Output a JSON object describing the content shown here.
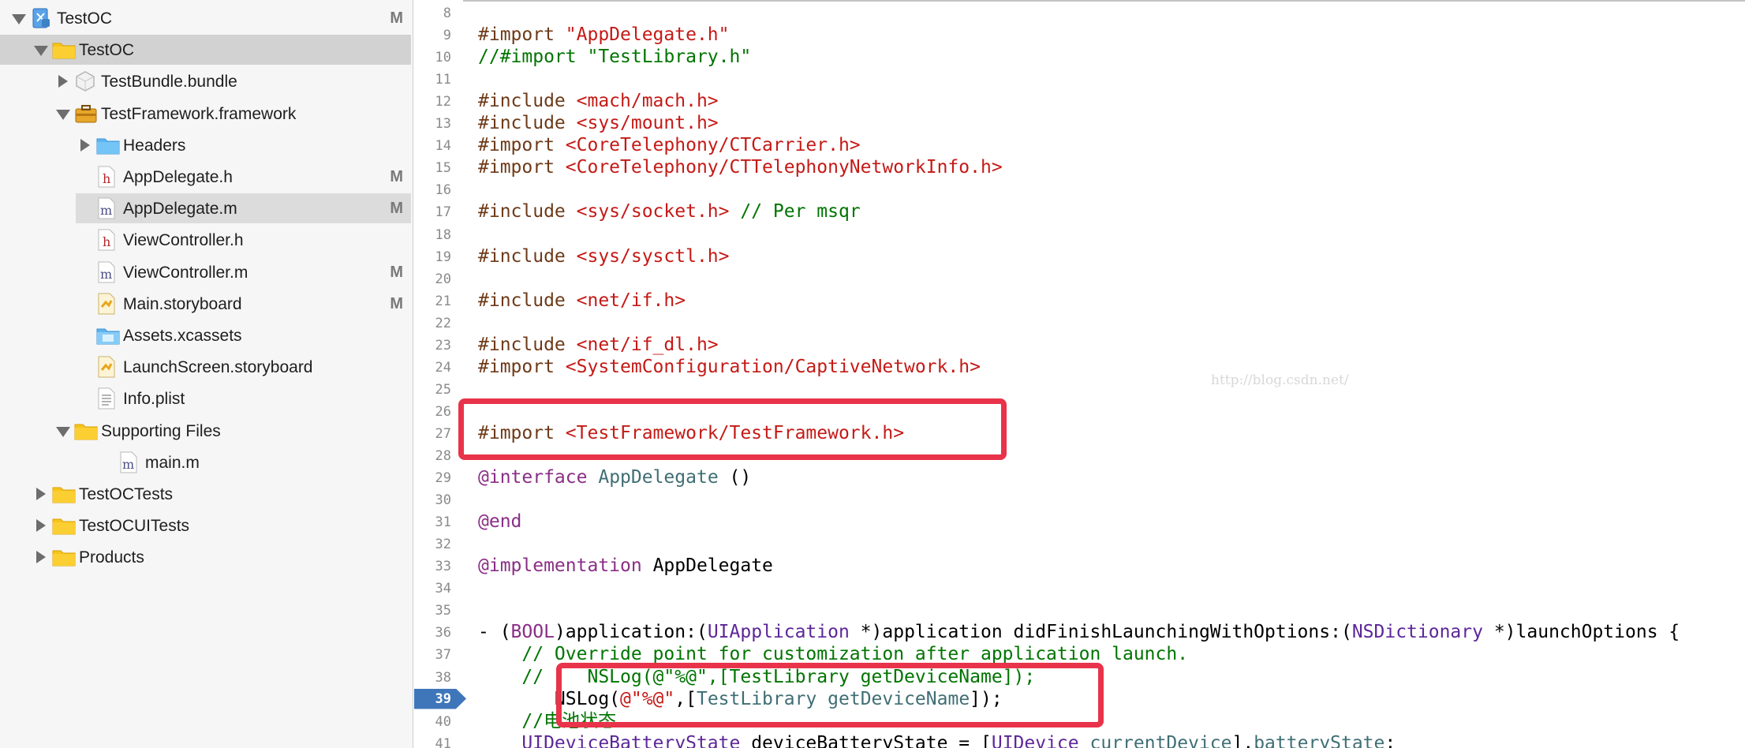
{
  "navigator": {
    "rows": [
      {
        "label": "TestOC",
        "badge": "M",
        "icon": "project-icon",
        "depth": 0,
        "disclosure": "open"
      },
      {
        "label": "TestOC",
        "badge": "",
        "icon": "folder-icon",
        "depth": 1,
        "disclosure": "open",
        "selected": true
      },
      {
        "label": "TestBundle.bundle",
        "badge": "",
        "icon": "bundle-icon",
        "depth": 2,
        "disclosure": "closed"
      },
      {
        "label": "TestFramework.framework",
        "badge": "",
        "icon": "framework-icon",
        "depth": 2,
        "disclosure": "open"
      },
      {
        "label": "Headers",
        "badge": "",
        "icon": "blue-folder-icon",
        "depth": 3,
        "disclosure": "closed"
      },
      {
        "label": "AppDelegate.h",
        "badge": "M",
        "icon": "header-file-icon",
        "depth": 3,
        "disclosure": ""
      },
      {
        "label": "AppDelegate.m",
        "badge": "M",
        "icon": "objc-file-icon",
        "depth": 3,
        "disclosure": "",
        "current": true
      },
      {
        "label": "ViewController.h",
        "badge": "",
        "icon": "header-file-icon",
        "depth": 3,
        "disclosure": ""
      },
      {
        "label": "ViewController.m",
        "badge": "M",
        "icon": "objc-file-icon",
        "depth": 3,
        "disclosure": ""
      },
      {
        "label": "Main.storyboard",
        "badge": "M",
        "icon": "storyboard-icon",
        "depth": 3,
        "disclosure": ""
      },
      {
        "label": "Assets.xcassets",
        "badge": "",
        "icon": "assets-icon",
        "depth": 3,
        "disclosure": ""
      },
      {
        "label": "LaunchScreen.storyboard",
        "badge": "",
        "icon": "storyboard-icon",
        "depth": 3,
        "disclosure": ""
      },
      {
        "label": "Info.plist",
        "badge": "",
        "icon": "plist-icon",
        "depth": 3,
        "disclosure": ""
      },
      {
        "label": "Supporting Files",
        "badge": "",
        "icon": "folder-icon",
        "depth": 2,
        "disclosure": "open"
      },
      {
        "label": "main.m",
        "badge": "",
        "icon": "objc-file-icon",
        "depth": 4,
        "disclosure": ""
      },
      {
        "label": "TestOCTests",
        "badge": "",
        "icon": "folder-icon",
        "depth": 1,
        "disclosure": "closed"
      },
      {
        "label": "TestOCUITests",
        "badge": "",
        "icon": "folder-icon",
        "depth": 1,
        "disclosure": "closed"
      },
      {
        "label": "Products",
        "badge": "",
        "icon": "folder-icon",
        "depth": 1,
        "disclosure": "closed"
      }
    ]
  },
  "editor": {
    "watermark": "http://blog.csdn.net/",
    "breakpoint_line": "39",
    "lines": [
      {
        "num": "8",
        "tokens": []
      },
      {
        "num": "9",
        "tokens": [
          [
            "pp",
            "#import "
          ],
          [
            "str",
            "\"AppDelegate.h\""
          ]
        ]
      },
      {
        "num": "10",
        "tokens": [
          [
            "cmt",
            "//#import \"TestLibrary.h\""
          ]
        ]
      },
      {
        "num": "11",
        "tokens": []
      },
      {
        "num": "12",
        "tokens": [
          [
            "pp",
            "#include "
          ],
          [
            "str",
            "<mach/mach.h>"
          ]
        ]
      },
      {
        "num": "13",
        "tokens": [
          [
            "pp",
            "#include "
          ],
          [
            "str",
            "<sys/mount.h>"
          ]
        ]
      },
      {
        "num": "14",
        "tokens": [
          [
            "pp",
            "#import "
          ],
          [
            "str",
            "<CoreTelephony/CTCarrier.h>"
          ]
        ]
      },
      {
        "num": "15",
        "tokens": [
          [
            "pp",
            "#import "
          ],
          [
            "str",
            "<CoreTelephony/CTTelephonyNetworkInfo.h>"
          ]
        ]
      },
      {
        "num": "16",
        "tokens": []
      },
      {
        "num": "17",
        "tokens": [
          [
            "pp",
            "#include "
          ],
          [
            "str",
            "<sys/socket.h>"
          ],
          [
            "cmt",
            " // Per msqr"
          ]
        ]
      },
      {
        "num": "18",
        "tokens": []
      },
      {
        "num": "19",
        "tokens": [
          [
            "pp",
            "#include "
          ],
          [
            "str",
            "<sys/sysctl.h>"
          ]
        ]
      },
      {
        "num": "20",
        "tokens": []
      },
      {
        "num": "21",
        "tokens": [
          [
            "pp",
            "#include "
          ],
          [
            "str",
            "<net/if.h>"
          ]
        ]
      },
      {
        "num": "22",
        "tokens": []
      },
      {
        "num": "23",
        "tokens": [
          [
            "pp",
            "#include "
          ],
          [
            "str",
            "<net/if_dl.h>"
          ]
        ]
      },
      {
        "num": "24",
        "tokens": [
          [
            "pp",
            "#import "
          ],
          [
            "str",
            "<SystemConfiguration/CaptiveNetwork.h>"
          ]
        ]
      },
      {
        "num": "25",
        "tokens": []
      },
      {
        "num": "26",
        "tokens": []
      },
      {
        "num": "27",
        "tokens": [
          [
            "pp",
            "#import "
          ],
          [
            "str",
            "<TestFramework/TestFramework.h>"
          ]
        ]
      },
      {
        "num": "28",
        "tokens": []
      },
      {
        "num": "29",
        "tokens": [
          [
            "kw",
            "@interface"
          ],
          [
            "plain",
            " "
          ],
          [
            "cls",
            "AppDelegate"
          ],
          [
            "plain",
            " ()"
          ]
        ]
      },
      {
        "num": "30",
        "tokens": []
      },
      {
        "num": "31",
        "tokens": [
          [
            "kw",
            "@end"
          ]
        ]
      },
      {
        "num": "32",
        "tokens": []
      },
      {
        "num": "33",
        "tokens": [
          [
            "kw",
            "@implementation"
          ],
          [
            "plain",
            " AppDelegate"
          ]
        ]
      },
      {
        "num": "34",
        "tokens": []
      },
      {
        "num": "35",
        "tokens": []
      },
      {
        "num": "36",
        "tokens": [
          [
            "plain",
            "- ("
          ],
          [
            "kw",
            "BOOL"
          ],
          [
            "plain",
            ")application:("
          ],
          [
            "pcls",
            "UIApplication"
          ],
          [
            "plain",
            " *)application didFinishLaunchingWithOptions:("
          ],
          [
            "pcls",
            "NSDictionary"
          ],
          [
            "plain",
            " *)launchOptions {"
          ]
        ]
      },
      {
        "num": "37",
        "tokens": [
          [
            "cmt",
            "    // Override point for customization after application launch."
          ]
        ]
      },
      {
        "num": "38",
        "tokens": [
          [
            "cmt",
            "    //    NSLog(@\"%@\",[TestLibrary getDeviceName]);"
          ]
        ]
      },
      {
        "num": "39",
        "tokens": [
          [
            "plain",
            "       NSLog("
          ],
          [
            "str",
            "@\"%@\""
          ],
          [
            "plain",
            ",["
          ],
          [
            "cls",
            "TestLibrary"
          ],
          [
            "plain",
            " "
          ],
          [
            "cls",
            "getDeviceName"
          ],
          [
            "plain",
            "]);"
          ]
        ]
      },
      {
        "num": "40",
        "tokens": [
          [
            "cmt",
            "    //电池状态"
          ]
        ]
      },
      {
        "num": "41",
        "tokens": [
          [
            "plain",
            "    "
          ],
          [
            "pcls",
            "UIDeviceBatteryState"
          ],
          [
            "plain",
            " deviceBatteryState = ["
          ],
          [
            "pcls",
            "UIDevice"
          ],
          [
            "plain",
            " "
          ],
          [
            "cls",
            "currentDevice"
          ],
          [
            "plain",
            "]."
          ],
          [
            "cls",
            "batteryState"
          ],
          [
            "plain",
            ";"
          ]
        ]
      }
    ]
  },
  "colors": {
    "preprocessor": "#6e3a19",
    "string": "#c41a16",
    "comment": "#007400",
    "keyword": "#8a2e86",
    "class": "#3f6e74",
    "project_class": "#5c2699",
    "highlight_box": "#e8334a",
    "breakpoint": "#3f76ba",
    "selection": "#d2d2d2"
  }
}
